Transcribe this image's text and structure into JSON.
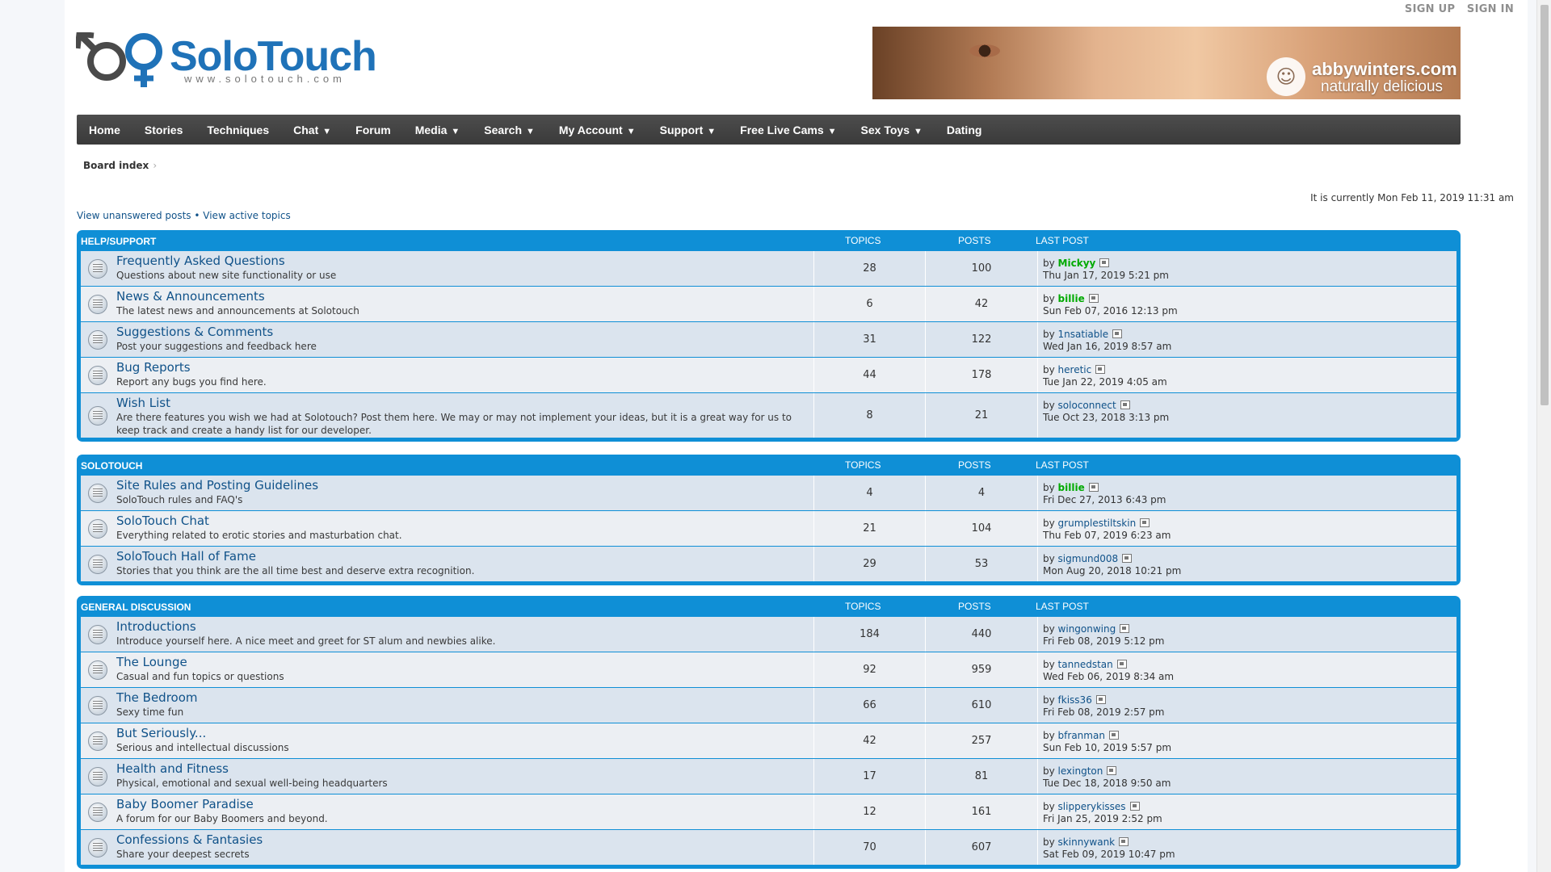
{
  "header": {
    "signup_label": "SIGN UP",
    "signin_label": "SIGN IN",
    "logo_text": "SoloTouch",
    "logo_url_text": "www.solotouch.com",
    "banner_line1": "abbywinters.com",
    "banner_line2": "naturally delicious"
  },
  "nav": {
    "items": [
      {
        "label": "Home",
        "dropdown": false
      },
      {
        "label": "Stories",
        "dropdown": false
      },
      {
        "label": "Techniques",
        "dropdown": false
      },
      {
        "label": "Chat",
        "dropdown": true
      },
      {
        "label": "Forum",
        "dropdown": false
      },
      {
        "label": "Media",
        "dropdown": true
      },
      {
        "label": "Search",
        "dropdown": true
      },
      {
        "label": "My Account",
        "dropdown": true
      },
      {
        "label": "Support",
        "dropdown": true
      },
      {
        "label": "Free Live Cams",
        "dropdown": true
      },
      {
        "label": "Sex Toys",
        "dropdown": true
      },
      {
        "label": "Dating",
        "dropdown": false
      }
    ],
    "caret": "▼"
  },
  "breadcrumb": {
    "label": "Board index",
    "separator": "›"
  },
  "current_time": "It is currently Mon Feb 11, 2019 11:31 am",
  "quicklinks": {
    "unanswered": "View unanswered posts",
    "separator": " • ",
    "active": "View active topics"
  },
  "columns": {
    "topics": "TOPICS",
    "posts": "POSTS",
    "last_post": "LAST POST"
  },
  "by_label": "by",
  "colors": {
    "category_blue": "#0f8fd6",
    "link": "#105289",
    "moderator_green": "#00aa00"
  },
  "categories": [
    {
      "name": "HELP/SUPPORT",
      "forums": [
        {
          "title": "Frequently Asked Questions",
          "desc": "Questions about new site functionality or use",
          "topics": "28",
          "posts": "100",
          "author": "Mickyy",
          "author_green": true,
          "date": "Thu Jan 17, 2019 5:21 pm"
        },
        {
          "title": "News & Announcements",
          "desc": "The latest news and announcements at Solotouch",
          "topics": "6",
          "posts": "42",
          "author": "billie",
          "author_green": true,
          "date": "Sun Feb 07, 2016 12:13 pm"
        },
        {
          "title": "Suggestions & Comments",
          "desc": "Post your suggestions and feedback here",
          "topics": "31",
          "posts": "122",
          "author": "1nsatiable",
          "author_green": false,
          "date": "Wed Jan 16, 2019 8:57 am"
        },
        {
          "title": "Bug Reports",
          "desc": "Report any bugs you find here.",
          "topics": "44",
          "posts": "178",
          "author": "heretic",
          "author_green": false,
          "date": "Tue Jan 22, 2019 4:05 am"
        },
        {
          "title": "Wish List",
          "desc": "Are there features you wish we had at Solotouch? Post them here. We may or may not implement your ideas, but it is a great way for us to keep track and create a handy list for our developer.",
          "topics": "8",
          "posts": "21",
          "author": "soloconnect",
          "author_green": false,
          "date": "Tue Oct 23, 2018 3:13 pm",
          "tall": true
        }
      ]
    },
    {
      "name": "SOLOTOUCH",
      "forums": [
        {
          "title": "Site Rules and Posting Guidelines",
          "desc": "SoloTouch rules and FAQ's",
          "topics": "4",
          "posts": "4",
          "author": "billie",
          "author_green": true,
          "date": "Fri Dec 27, 2013 6:43 pm"
        },
        {
          "title": "SoloTouch Chat",
          "desc": "Everything related to erotic stories and masturbation chat.",
          "topics": "21",
          "posts": "104",
          "author": "grumplestiltskin",
          "author_green": false,
          "date": "Thu Feb 07, 2019 6:23 am"
        },
        {
          "title": "SoloTouch Hall of Fame",
          "desc": "Stories that you think are the all time best and deserve extra recognition.",
          "topics": "29",
          "posts": "53",
          "author": "sigmund008",
          "author_green": false,
          "date": "Mon Aug 20, 2018 10:21 pm"
        }
      ]
    },
    {
      "name": "GENERAL DISCUSSION",
      "forums": [
        {
          "title": "Introductions",
          "desc": "Introduce yourself here. A nice meet and greet for ST alum and newbies alike.",
          "topics": "184",
          "posts": "440",
          "author": "wingonwing",
          "author_green": false,
          "date": "Fri Feb 08, 2019 5:12 pm"
        },
        {
          "title": "The Lounge",
          "desc": "Casual and fun topics or questions",
          "topics": "92",
          "posts": "959",
          "author": "tannedstan",
          "author_green": false,
          "date": "Wed Feb 06, 2019 8:34 am"
        },
        {
          "title": "The Bedroom",
          "desc": "Sexy time fun",
          "topics": "66",
          "posts": "610",
          "author": "fkiss36",
          "author_green": false,
          "date": "Fri Feb 08, 2019 2:57 pm"
        },
        {
          "title": "But Seriously...",
          "desc": "Serious and intellectual discussions",
          "topics": "42",
          "posts": "257",
          "author": "bfranman",
          "author_green": false,
          "date": "Sun Feb 10, 2019 5:57 pm"
        },
        {
          "title": "Health and Fitness",
          "desc": "Physical, emotional and sexual well-being headquarters",
          "topics": "17",
          "posts": "81",
          "author": "lexington",
          "author_green": false,
          "date": "Tue Dec 18, 2018 9:50 am"
        },
        {
          "title": "Baby Boomer Paradise",
          "desc": "A forum for our Baby Boomers and beyond.",
          "topics": "12",
          "posts": "161",
          "author": "slipperykisses",
          "author_green": false,
          "date": "Fri Jan 25, 2019 2:52 pm"
        },
        {
          "title": "Confessions & Fantasies",
          "desc": "Share your deepest secrets",
          "topics": "70",
          "posts": "607",
          "author": "skinnywank",
          "author_green": false,
          "date": "Sat Feb 09, 2019 10:47 pm"
        }
      ]
    }
  ]
}
